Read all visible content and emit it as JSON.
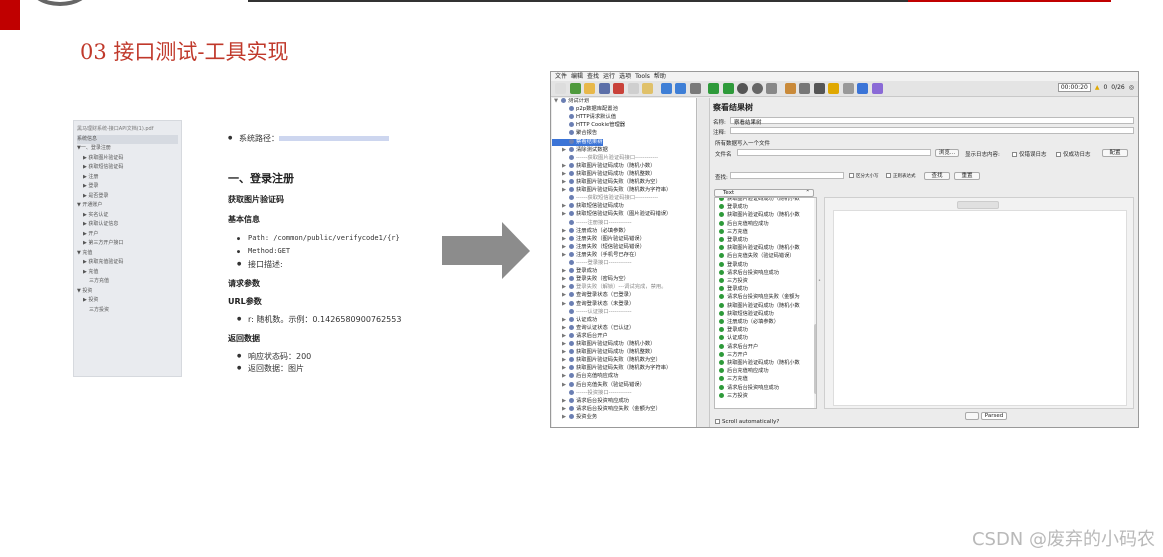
{
  "slide": {
    "title": "03 接口测试-工具实现",
    "watermark": "CSDN @废弃的小码农",
    "accent_color": "#c0392b"
  },
  "doc_sidebar": {
    "header": "黑马理财系统-接口API文档(1).pdf",
    "items": [
      "系统信息",
      "▼一、登录注册",
      "▶ 获取图片验证码",
      "▶ 获取短信验证码",
      "▶ 注册",
      "▶ 登录",
      "▶ 是否登录",
      "▼ 开通账户",
      "▶ 实名认证",
      "▶ 获取认证信息",
      "▶ 开户",
      "▶ 第三方开户接口",
      "▼ 充值",
      "▶ 获取充值验证码",
      "▶ 充值",
      "三方充值",
      "▼ 投资",
      "▶ 投资",
      "三方投资"
    ]
  },
  "doc_main": {
    "system_path_label": "系统路径：",
    "section": "一、登录注册",
    "api_title": "获取图片验证码",
    "basic_info": "基本信息",
    "path": "Path: /common/public/verifycode1/{r}",
    "method": "Method:GET",
    "desc": "接口描述:",
    "req_params": "请求参数",
    "url_params": "URL参数",
    "r_param": "r: 随机数。示例：0.1426580900762553",
    "return_data": "返回数据",
    "status_code": "响应状态码：200",
    "return_body": "返回数据：图片"
  },
  "jmeter": {
    "menu": [
      "文件",
      "编辑",
      "查找",
      "运行",
      "选项",
      "Tools",
      "帮助"
    ],
    "timer": "00:00:20",
    "warn_count": "0",
    "threads": "0/26",
    "tree": [
      {
        "t": "测试计划",
        "lvl": 0,
        "arw": "▼"
      },
      {
        "t": "p2p数据库配置池",
        "lvl": 1
      },
      {
        "t": "HTTP请求默认值",
        "lvl": 1
      },
      {
        "t": "HTTP Cookie管理器",
        "lvl": 1
      },
      {
        "t": "聚合报告",
        "lvl": 1
      },
      {
        "t": "察看结果树",
        "lvl": 1,
        "sel": true
      },
      {
        "t": "清除测试数据",
        "lvl": 1,
        "arw": "▶"
      },
      {
        "t": "------获取图片验证码接口------------",
        "lvl": 1,
        "dim": true
      },
      {
        "t": "获取图片验证码成功（随机小数）",
        "lvl": 1,
        "arw": "▶"
      },
      {
        "t": "获取图片验证码成功（随机整数）",
        "lvl": 1,
        "arw": "▶"
      },
      {
        "t": "获取图片验证码失败（随机数为空）",
        "lvl": 1,
        "arw": "▶"
      },
      {
        "t": "获取图片验证码失败（随机数为字符串）",
        "lvl": 1,
        "arw": "▶"
      },
      {
        "t": "------获取短信验证码接口------------",
        "lvl": 1,
        "dim": true
      },
      {
        "t": "获取短信验证码成功",
        "lvl": 1,
        "arw": "▶"
      },
      {
        "t": "获取短信验证码失败（图片验证码错误）",
        "lvl": 1,
        "arw": "▶"
      },
      {
        "t": "------注册接口------------",
        "lvl": 1,
        "dim": true
      },
      {
        "t": "注册成功（必填参数）",
        "lvl": 1,
        "arw": "▶"
      },
      {
        "t": "注册失败（图片验证码错误）",
        "lvl": 1,
        "arw": "▶"
      },
      {
        "t": "注册失败（短信验证码错误）",
        "lvl": 1,
        "arw": "▶"
      },
      {
        "t": "注册失败（手机号已存在）",
        "lvl": 1,
        "arw": "▶"
      },
      {
        "t": "------登录接口------------",
        "lvl": 1,
        "dim": true
      },
      {
        "t": "登录成功",
        "lvl": 1,
        "arw": "▶"
      },
      {
        "t": "登录失败（密码为空）",
        "lvl": 1,
        "arw": "▶"
      },
      {
        "t": "登录失败（解锁）---调试完成，禁用。",
        "lvl": 1,
        "arw": "▶",
        "dim": true
      },
      {
        "t": "查询登录状态（已登录）",
        "lvl": 1,
        "arw": "▶"
      },
      {
        "t": "查询登录状态（未登录）",
        "lvl": 1,
        "arw": "▶"
      },
      {
        "t": "------认证接口------------",
        "lvl": 1,
        "dim": true
      },
      {
        "t": "认证成功",
        "lvl": 1,
        "arw": "▶"
      },
      {
        "t": "查询认证状态（已认证）",
        "lvl": 1,
        "arw": "▶"
      },
      {
        "t": "请求后台开户",
        "lvl": 1,
        "arw": "▶"
      },
      {
        "t": "获取图片验证码成功（随机小数）",
        "lvl": 1,
        "arw": "▶"
      },
      {
        "t": "获取图片验证码成功（随机整数）",
        "lvl": 1,
        "arw": "▶"
      },
      {
        "t": "获取图片验证码失败（随机数为空）",
        "lvl": 1,
        "arw": "▶"
      },
      {
        "t": "获取图片验证码失败（随机数为字符串）",
        "lvl": 1,
        "arw": "▶"
      },
      {
        "t": "后台充值响应成功",
        "lvl": 1,
        "arw": "▶"
      },
      {
        "t": "后台充值失败（验证码错误）",
        "lvl": 1,
        "arw": "▶"
      },
      {
        "t": "------投资接口------------",
        "lvl": 1,
        "dim": true
      },
      {
        "t": "请求后台投资响应成功",
        "lvl": 1,
        "arw": "▶"
      },
      {
        "t": "请求后台投资响应失败（金额为空）",
        "lvl": 1,
        "arw": "▶"
      },
      {
        "t": "投资业务",
        "lvl": 1,
        "arw": "▶"
      }
    ],
    "panel": {
      "title": "察看结果树",
      "name_label": "名称:",
      "name_value": "察看结果树",
      "comment_label": "注释:",
      "write_all": "所有数据写入一个文件",
      "filename_label": "文件名",
      "browse": "浏览...",
      "log_content": "显示日志内容:",
      "errors_only": "仅错误日志",
      "success_only": "仅成功日志",
      "config": "配置",
      "search_label": "查找:",
      "case_sensitive": "区分大小写",
      "regex": "正则表达式",
      "search_btn": "查找",
      "reset_btn": "重置",
      "renderer": "Text",
      "parsed": "Parsed",
      "scroll_auto": "Scroll automatically?"
    },
    "results": [
      "获取图片验证码成功（随机小数",
      "登录成功",
      "获取图片验证码成功（随机小数",
      "后台充值响应成功",
      "三方充值",
      "登录成功",
      "获取图片验证码成功（随机小数",
      "后台充值失败（验证码错误）",
      "登录成功",
      "请求后台投资响应成功",
      "三方投资",
      "登录成功",
      "请求后台投资响应失败（金额为",
      "获取图片验证码成功（随机小数",
      "获取短信验证码成功",
      "注册成功（必填参数）",
      "登录成功",
      "认证成功",
      "请求后台开户",
      "三方开户",
      "获取图片验证码成功（随机小数",
      "后台充值响应成功",
      "三方充值",
      "请求后台投资响应成功",
      "三方投资"
    ]
  }
}
